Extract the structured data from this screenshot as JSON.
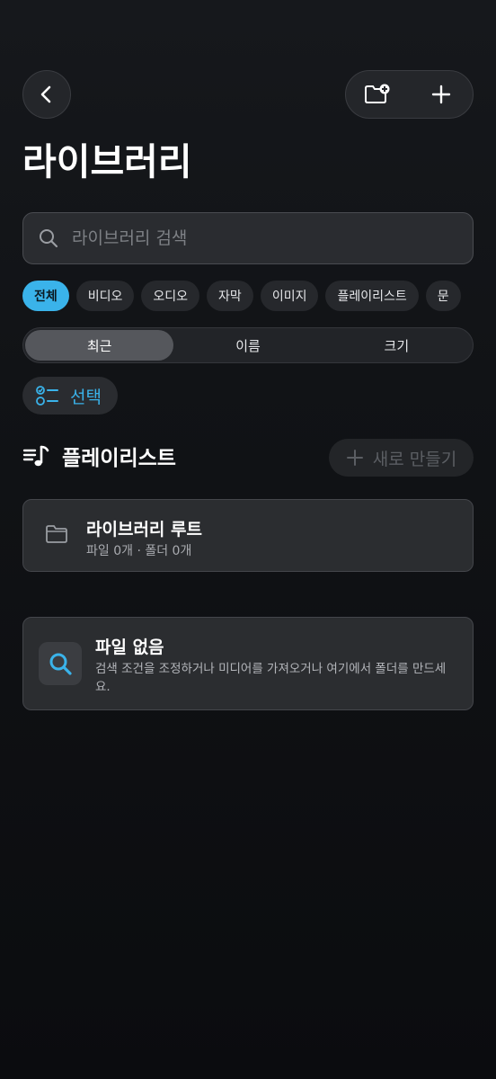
{
  "header": {
    "title": "라이브러리",
    "back_icon": "chevron-left-icon",
    "new_folder_icon": "folder-plus-icon",
    "add_icon": "plus-icon"
  },
  "search": {
    "placeholder": "라이브러리 검색",
    "value": ""
  },
  "filters": {
    "selected": "전체",
    "items": [
      "전체",
      "비디오",
      "오디오",
      "자막",
      "이미지",
      "플레이리스트",
      "문"
    ]
  },
  "sort": {
    "selected": "최근",
    "options": [
      "최근",
      "이름",
      "크기"
    ]
  },
  "select_button": {
    "label": "선택"
  },
  "playlist_section": {
    "title": "플레이리스트",
    "new_button_label": "새로 만들기"
  },
  "folder": {
    "name": "라이브러리 루트",
    "meta": "파일 0개 · 폴더 0개"
  },
  "empty_state": {
    "title": "파일 없음",
    "description": "검색 조건을 조정하거나 미디어를 가져오거나 여기에서 폴더를 만드세요."
  },
  "colors": {
    "accent": "#3ab3ea",
    "background": "#111316",
    "card": "#2b2d30"
  }
}
